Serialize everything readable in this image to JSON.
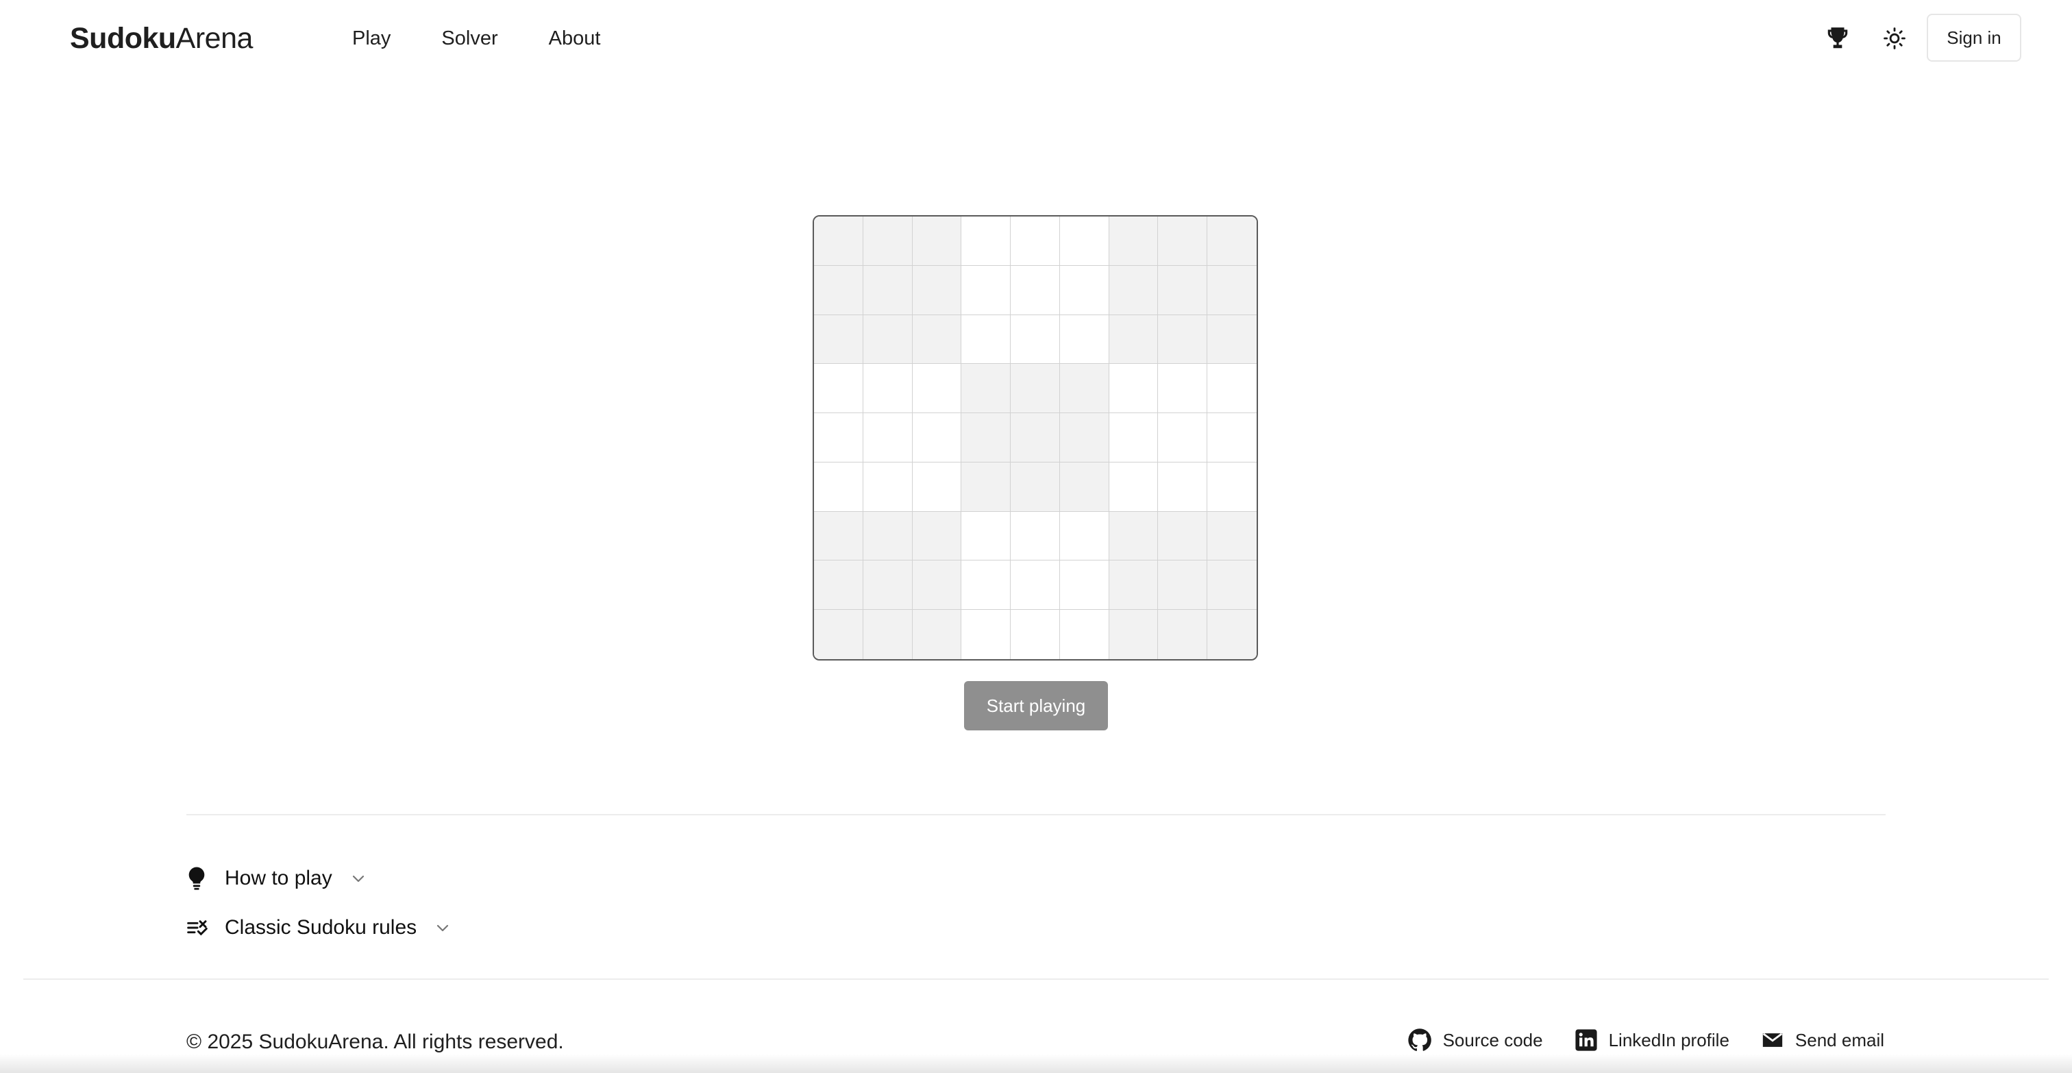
{
  "header": {
    "brand_bold": "Sudoku",
    "brand_light": "Arena",
    "nav": [
      {
        "label": "Play"
      },
      {
        "label": "Solver"
      },
      {
        "label": "About"
      }
    ],
    "icons": {
      "leaderboard": "trophy-icon",
      "theme_toggle": "sun-icon"
    },
    "signin_label": "Sign in"
  },
  "board": {
    "size": 9,
    "box_size": 3,
    "shaded_boxes": [
      [
        0,
        0
      ],
      [
        0,
        2
      ],
      [
        1,
        1
      ],
      [
        2,
        0
      ],
      [
        2,
        2
      ]
    ],
    "colors": {
      "shaded": "#f2f2f2",
      "unshaded": "#ffffff",
      "border": "#5a5a5a"
    },
    "start_label": "Start playing",
    "start_button_color": "#8f8f8f"
  },
  "info": {
    "how_to_play": {
      "label": "How to play",
      "icon": "lightbulb-icon"
    },
    "rules": {
      "label": "Classic Sudoku rules",
      "icon": "list-check-icon"
    }
  },
  "footer": {
    "copyright": "© 2025 SudokuArena. All rights reserved.",
    "links": [
      {
        "label": "Source code",
        "icon": "github-icon"
      },
      {
        "label": "LinkedIn profile",
        "icon": "linkedin-icon"
      },
      {
        "label": "Send email",
        "icon": "mail-icon"
      }
    ]
  }
}
